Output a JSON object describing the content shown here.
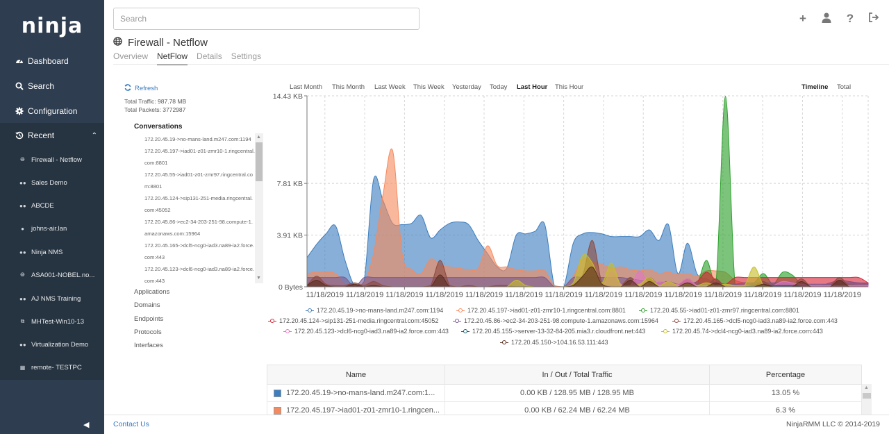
{
  "sidebar": {
    "logo": "ninja",
    "nav": [
      {
        "label": "Dashboard",
        "icon": "dashboard-icon"
      },
      {
        "label": "Search",
        "icon": "search-icon"
      },
      {
        "label": "Configuration",
        "icon": "gear-icon"
      }
    ],
    "recent": {
      "label": "Recent",
      "icon": "history-icon",
      "expanded": true
    },
    "recent_items": [
      {
        "label": "Firewall - Netflow",
        "icon": "globe-icon"
      },
      {
        "label": "Sales Demo",
        "icon": "users-icon"
      },
      {
        "label": "ABCDE",
        "icon": "users-icon"
      },
      {
        "label": "johns-air.lan",
        "icon": "apple-icon"
      },
      {
        "label": "Ninja NMS",
        "icon": "users-icon"
      },
      {
        "label": "ASA001-NOBEL.no...",
        "icon": "globe-icon"
      },
      {
        "label": "AJ NMS Training",
        "icon": "users-icon"
      },
      {
        "label": "MHTest-Win10-13",
        "icon": "vm-icon"
      },
      {
        "label": "Virtualization Demo",
        "icon": "users-icon"
      },
      {
        "label": "remote- TESTPC",
        "icon": "windows-icon"
      }
    ]
  },
  "header": {
    "search_placeholder": "Search",
    "actions": [
      "add-icon",
      "user-icon",
      "help-icon",
      "logout-icon"
    ]
  },
  "page": {
    "title": "Firewall - Netflow",
    "tabs": [
      {
        "label": "Overview",
        "active": false
      },
      {
        "label": "NetFlow",
        "active": true
      },
      {
        "label": "Details",
        "active": false
      },
      {
        "label": "Settings",
        "active": false
      }
    ]
  },
  "netflow": {
    "refresh_label": "Refresh",
    "total_traffic": "Total Traffic: 987.78 MB",
    "total_packets": "Total Packets: 3772987",
    "conversations_title": "Conversations",
    "conversations": [
      "172.20.45.19->no-mans-land.m247.com:1194",
      "172.20.45.197->iad01-z01-zmr10-1.ringcentral.com:8801",
      "172.20.45.55->iad01-z01-zmr97.ringcentral.com:8801",
      "172.20.45.124->sip131-251-media.ringcentral.com:45052",
      "172.20.45.86->ec2-34-203-251-98.compute-1.amazonaws.com:15964",
      "172.20.45.165->dcl5-ncg0-iad3.na89-ia2.force.com:443",
      "172.20.45.123->dcl6-ncg0-iad3.na89-ia2.force.com:443"
    ],
    "categories": [
      "Applications",
      "Domains",
      "Endpoints",
      "Protocols",
      "Interfaces"
    ],
    "time_ranges": [
      {
        "label": "Last Month",
        "active": false
      },
      {
        "label": "This Month",
        "active": false
      },
      {
        "label": "Last Week",
        "active": false
      },
      {
        "label": "This Week",
        "active": false
      },
      {
        "label": "Yesterday",
        "active": false
      },
      {
        "label": "Today",
        "active": false
      },
      {
        "label": "Last Hour",
        "active": true
      },
      {
        "label": "This Hour",
        "active": false
      }
    ],
    "view_modes": [
      {
        "label": "Timeline",
        "active": true
      },
      {
        "label": "Total",
        "active": false
      }
    ]
  },
  "chart_data": {
    "type": "area",
    "title": "",
    "xlabel": "",
    "ylabel": "",
    "y_ticks": [
      "0 Bytes",
      "3.91 KB",
      "7.81 KB",
      "14.43 KB"
    ],
    "y_tick_values_kb": [
      0,
      3.91,
      7.81,
      14.43
    ],
    "ylim_kb": [
      0,
      14.43
    ],
    "x_ticks": [
      "11/18/2019",
      "11/18/2019",
      "11/18/2019",
      "11/18/2019",
      "11/18/2019",
      "11/18/2019",
      "11/18/2019",
      "11/18/2019",
      "11/18/2019",
      "11/18/2019",
      "11/18/2019",
      "11/18/2019",
      "11/18/2019",
      "11/18/2019",
      "11/18/2019"
    ],
    "grid": true,
    "legend_position": "bottom",
    "x_points": 60,
    "series": [
      {
        "name": "172.20.45.19->no-mans-land.m247.com:1194",
        "color": "#3d7ebf",
        "values": [
          2.2,
          3.2,
          4.0,
          4.6,
          2.0,
          0.1,
          0.4,
          8.1,
          6.5,
          4.8,
          4.7,
          4.8,
          5.4,
          3.7,
          4.3,
          4.8,
          4.9,
          4.7,
          3.5,
          2.5,
          1.5,
          1.4,
          3.9,
          4.0,
          4.2,
          4.7,
          0.1,
          0.0,
          3.3,
          4.0,
          4.1,
          4.0,
          3.8,
          3.8,
          3.8,
          3.8,
          4.3,
          3.5,
          4.7,
          1.0,
          3.3,
          1.0,
          0.6,
          0.3,
          0.2,
          0.2,
          0.1,
          0.1,
          0.1,
          0.1,
          0.1,
          0.1,
          0.1,
          0.1,
          0.1,
          0.3,
          0.5,
          0.4,
          0.3,
          0.3
        ]
      },
      {
        "name": "172.20.45.197->iad01-z01-zmr10-1.ringcentral.com:8801",
        "color": "#f58a5e",
        "values": [
          1.0,
          1.1,
          1.1,
          1.0,
          0.2,
          0.1,
          0.3,
          2.5,
          7.0,
          10.3,
          2.5,
          1.3,
          1.0,
          2.1,
          1.6,
          1.5,
          1.4,
          1.3,
          1.4,
          3.1,
          1.6,
          1.5,
          1.3,
          1.2,
          1.2,
          1.2,
          0.1,
          0.0,
          0.8,
          2.1,
          1.9,
          1.7,
          1.4,
          1.5,
          1.3,
          1.2,
          1.3,
          1.0,
          1.1,
          0.9,
          1.0,
          0.8,
          1.2,
          1.2,
          1.1,
          0.5,
          0.3,
          0.2,
          0.1,
          0.1,
          0.1,
          0.1,
          0.1,
          0.1,
          0.1,
          0.1,
          0.1,
          0.1,
          0.1,
          0.1
        ]
      },
      {
        "name": "172.20.45.55->iad01-z01-zmr97.ringcentral.com:8801",
        "color": "#2ca02c",
        "values": [
          0,
          0,
          0,
          0,
          0,
          0,
          0,
          0,
          0,
          0,
          0,
          0,
          0,
          0,
          0,
          0,
          0,
          0,
          0,
          0,
          0,
          0,
          0,
          0,
          0,
          0,
          0,
          0,
          0,
          0,
          0,
          0,
          0,
          0,
          0,
          0,
          0,
          0,
          0,
          0,
          0.1,
          0.2,
          2.0,
          0.3,
          14.4,
          0.2,
          0.1,
          0.3,
          1.0,
          0.2,
          1.1,
          0.9,
          0.2,
          0.1,
          0.1,
          0.1,
          0.2,
          0.2,
          0.1,
          0.1
        ]
      },
      {
        "name": "172.20.45.124->sip131-251-media.ringcentral.com:45052",
        "color": "#d62739",
        "values": [
          0,
          0,
          0,
          0,
          0,
          0,
          0,
          0,
          0,
          0,
          0,
          0,
          0,
          0,
          0,
          0,
          0,
          0,
          0,
          0,
          0,
          0,
          0,
          0,
          0,
          0,
          0,
          0,
          0,
          0,
          0,
          0,
          0,
          0,
          0,
          0,
          0,
          0,
          0,
          0,
          0.2,
          0.4,
          1.1,
          0.5,
          0.2,
          0.7,
          0.7,
          0.7,
          0.7,
          0.7,
          0.7,
          0.7,
          0.7,
          0.7,
          0.7,
          0.7,
          0.7,
          0.7,
          0.7,
          0.3
        ]
      },
      {
        "name": "172.20.45.86->ec2-34-203-251-98.compute-1.amazonaws.com:15964",
        "color": "#7b5a8e",
        "values": [
          0.7,
          0.7,
          0.7,
          0.7,
          0.7,
          0.0,
          0.7,
          0.7,
          0.7,
          0.7,
          0.7,
          0.7,
          0.7,
          0.7,
          0.7,
          0.7,
          0.7,
          0.7,
          0.7,
          0.7,
          0.7,
          0.7,
          0.7,
          0.7,
          0.7,
          0.7,
          0.0,
          0.0,
          0.7,
          0.7,
          0.7,
          0.7,
          0.7,
          0.7,
          0.6,
          0.5,
          0.4,
          0.3,
          0.4,
          0.2,
          0.3,
          0.3,
          0.2,
          0.3,
          0.2,
          0.2,
          0.3,
          0.3,
          0.3,
          0.3,
          0.3,
          0.3,
          0.2,
          0.2,
          0.2,
          0.2,
          0.3,
          0.3,
          0.3,
          0.2
        ]
      },
      {
        "name": "172.20.45.165->dcl5-ncg0-iad3.na89-ia2.force.com:443",
        "color": "#8c4b3f",
        "values": [
          0.1,
          0.8,
          0.2,
          0.1,
          0.1,
          0.3,
          0.1,
          0.4,
          0.1,
          0.0,
          0.0,
          0.0,
          0.0,
          0.1,
          2.0,
          0.1,
          0.0,
          0.1,
          0.0,
          0.0,
          0.1,
          0.1,
          0.0,
          0.0,
          0.0,
          0.0,
          0.0,
          0.0,
          0.2,
          0.9,
          3.5,
          0.3,
          0.1,
          0.1,
          0.7,
          0.1,
          0.7,
          0.1,
          0.0,
          0.1,
          0.6,
          0.1,
          0.1,
          0.6,
          0.0,
          0.1,
          0.1,
          0.1,
          0.4,
          0.0,
          0.1,
          0.1,
          0.6,
          0.0,
          0.0,
          0.1,
          0.7,
          0.1,
          0.1,
          0.0
        ]
      },
      {
        "name": "172.20.45.123->dcl6-ncg0-iad3.na89-ia2.force.com:443",
        "color": "#e377c2",
        "values": [
          0,
          0,
          0,
          0,
          0,
          0,
          0,
          0,
          0,
          0,
          0,
          0,
          0,
          0,
          0,
          0,
          0,
          0,
          0,
          0,
          0,
          0,
          0,
          0,
          0,
          0,
          0,
          0,
          0,
          0,
          0,
          0,
          1.1,
          0.2,
          0.1,
          1.2,
          0.1,
          0.4,
          0.3,
          0.2,
          0.6,
          0.1,
          0.1,
          0.1,
          0.1,
          0.1,
          0.1,
          0.1,
          0.1,
          0.1,
          0.4,
          0.3,
          0.2,
          0.1,
          0.1,
          0.1,
          0.1,
          0.1,
          0.1,
          0.1
        ]
      },
      {
        "name": "172.20.45.155->server-13-32-84-205.mia3.r.cloudfront.net:443",
        "color": "#17606b",
        "values": [
          0,
          0,
          0,
          0,
          0,
          0,
          0,
          0,
          0,
          0,
          0,
          0,
          0,
          0,
          0,
          0,
          0,
          0,
          0,
          0,
          0,
          0,
          0,
          0,
          0,
          0,
          0,
          0,
          0,
          0,
          0,
          0,
          0,
          0,
          0,
          0,
          0,
          0,
          0,
          0,
          0,
          0,
          0,
          0,
          0,
          0,
          0,
          0.1,
          0.1,
          0.1,
          0.1,
          0.1,
          0.0,
          0.0,
          0.0,
          0.0,
          0.0,
          0.0,
          0.0,
          0.0
        ]
      },
      {
        "name": "172.20.45.74->dcl4-ncg0-iad3.na89-ia2.force.com:443",
        "color": "#c7bd2a",
        "values": [
          0,
          0,
          0,
          0,
          0,
          0,
          0,
          0,
          0,
          0,
          0,
          0,
          0,
          0,
          0,
          0,
          0,
          0,
          0,
          0,
          0,
          0,
          0.5,
          0.1,
          0,
          0,
          0,
          0,
          0.3,
          2.4,
          1.8,
          0.3,
          1.8,
          0.1,
          0.1,
          0.2,
          0.7,
          0.1,
          0.4,
          0.1,
          0.2,
          0.1,
          0.3,
          0.1,
          0.2,
          0.1,
          0.1,
          1.5,
          0.1,
          0.0,
          0.0,
          0.0,
          0.0,
          0.0,
          0.0,
          0.0,
          0.0,
          0.0,
          0.0,
          0.0
        ]
      },
      {
        "name": "172.20.45.150->104.16.53.111:443",
        "color": "#5b2e22",
        "values": [
          0.1,
          0.5,
          0.1,
          0.0,
          0.0,
          0.2,
          0.0,
          0.1,
          0.0,
          0.0,
          0.0,
          0.0,
          0.0,
          0.0,
          0.9,
          0.0,
          0.0,
          0.0,
          0.0,
          0.0,
          0.0,
          0.0,
          0.0,
          0.0,
          0.0,
          0.0,
          0.0,
          0.0,
          0.1,
          0.8,
          1.5,
          0.2,
          0.0,
          0.0,
          0.5,
          0.0,
          0.4,
          0.0,
          0.0,
          0.0,
          0.3,
          0.0,
          0.0,
          0.3,
          0.0,
          0.0,
          0.0,
          0.0,
          0.2,
          0.0,
          0.0,
          0.0,
          0.4,
          0.0,
          0.0,
          0.0,
          0.5,
          0.0,
          0.0,
          0.0
        ]
      }
    ]
  },
  "table": {
    "columns": [
      "Name",
      "In / Out / Total Traffic",
      "Percentage"
    ],
    "rows": [
      {
        "color": "#3d7ebf",
        "name": "172.20.45.19->no-mans-land.m247.com:1...",
        "traffic": "0.00 KB / 128.95 MB / 128.95 MB",
        "percentage": "13.05 %"
      },
      {
        "color": "#f58a5e",
        "name": "172.20.45.197->iad01-z01-zmr10-1.ringcen...",
        "traffic": "0.00 KB / 62.24 MB / 62.24 MB",
        "percentage": "6.3 %"
      }
    ]
  },
  "footer": {
    "contact": "Contact Us",
    "copyright": "NinjaRMM LLC © 2014-2019"
  }
}
